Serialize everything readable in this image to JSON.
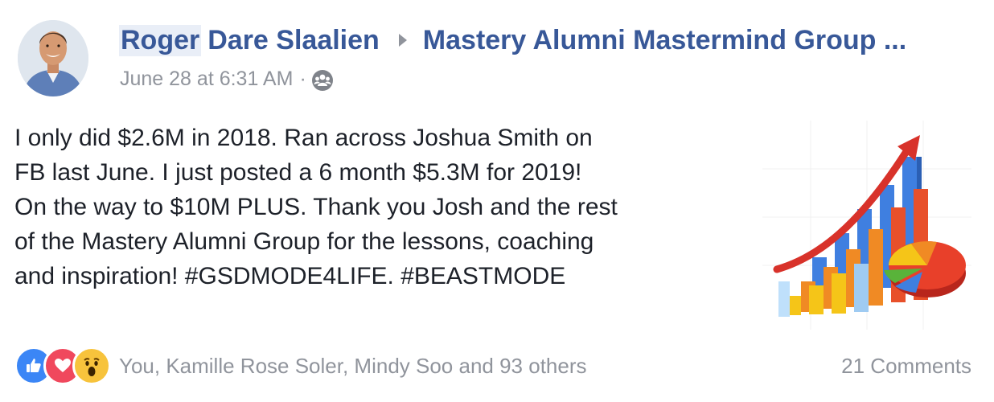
{
  "post": {
    "author_first": "Roger",
    "author_rest": "Dare Slaalien",
    "group_name": "Mastery Alumni Mastermind Group ...",
    "timestamp": "June 28 at 6:31 AM",
    "meta_separator": "·",
    "audience_icon": "group-audience-icon",
    "body": "I only did $2.6M in 2018. Ran across Joshua Smith on\nFB last June. I just posted a 6 month $5.3M for 2019!\nOn the way to $10M PLUS. Thank you Josh and the rest\nof the Mastery Alumni Group for the lessons, coaching\nand inspiration! #GSDMODE4LIFE. #BEASTMODE"
  },
  "reactions": {
    "icons": [
      "like-reaction-icon",
      "love-reaction-icon",
      "wow-reaction-icon"
    ],
    "summary": "You, Kamille Rose Soler, Mindy Soo and 93 others"
  },
  "comments": {
    "label": "21 Comments"
  },
  "colors": {
    "link": "#385898",
    "meta": "#90949c",
    "text": "#1d2129",
    "like": "#3b86f6",
    "love": "#f0485d",
    "wow": "#f7c33c"
  }
}
